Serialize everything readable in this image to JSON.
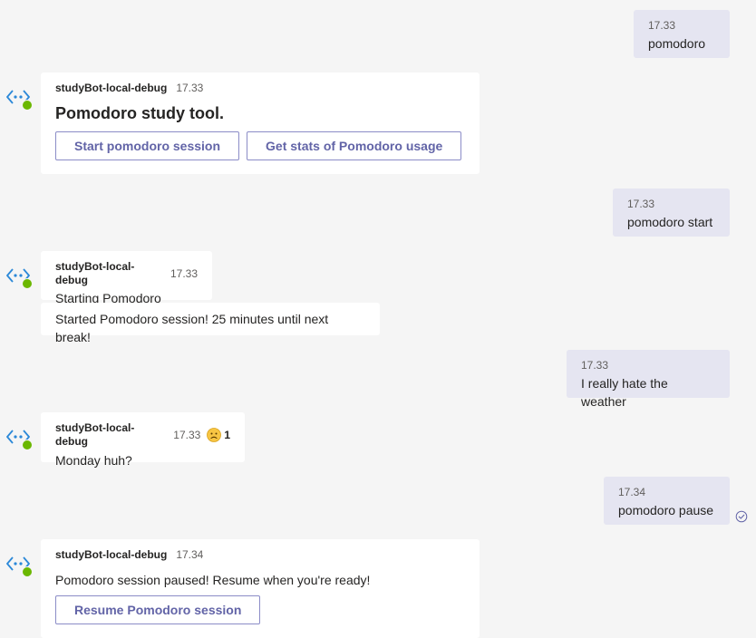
{
  "bot": {
    "name": "studyBot-local-debug",
    "avatar_icon": "bot-diamond-icon",
    "status_color": "#6bb700"
  },
  "colors": {
    "background": "#f5f5f5",
    "user_bubble": "#e5e5f1",
    "bot_bubble": "#ffffff",
    "button_text": "#6264a7"
  },
  "messages": [
    {
      "from": "user",
      "time": "17.33",
      "text": "pomodoro"
    },
    {
      "from": "bot",
      "time": "17.33",
      "card_title": "Pomodoro study tool.",
      "buttons": [
        "Start pomodoro session",
        "Get stats of Pomodoro usage"
      ]
    },
    {
      "from": "user",
      "time": "17.33",
      "text": "pomodoro start"
    },
    {
      "from": "bot",
      "time": "17.33",
      "text": "Starting Pomodoro",
      "followup": "Started Pomodoro session! 25 minutes until next break!"
    },
    {
      "from": "user",
      "time": "17.33",
      "text": "I really hate the weather"
    },
    {
      "from": "bot",
      "time": "17.33",
      "text": "Monday huh?",
      "reaction": {
        "icon": "sad-face-icon",
        "count": "1"
      }
    },
    {
      "from": "user",
      "time": "17.34",
      "text": "pomodoro pause",
      "read_receipt_icon": "seen-check-icon"
    },
    {
      "from": "bot",
      "time": "17.34",
      "text": "Pomodoro session paused! Resume when you're ready!",
      "buttons": [
        "Resume Pomodoro session"
      ]
    }
  ]
}
